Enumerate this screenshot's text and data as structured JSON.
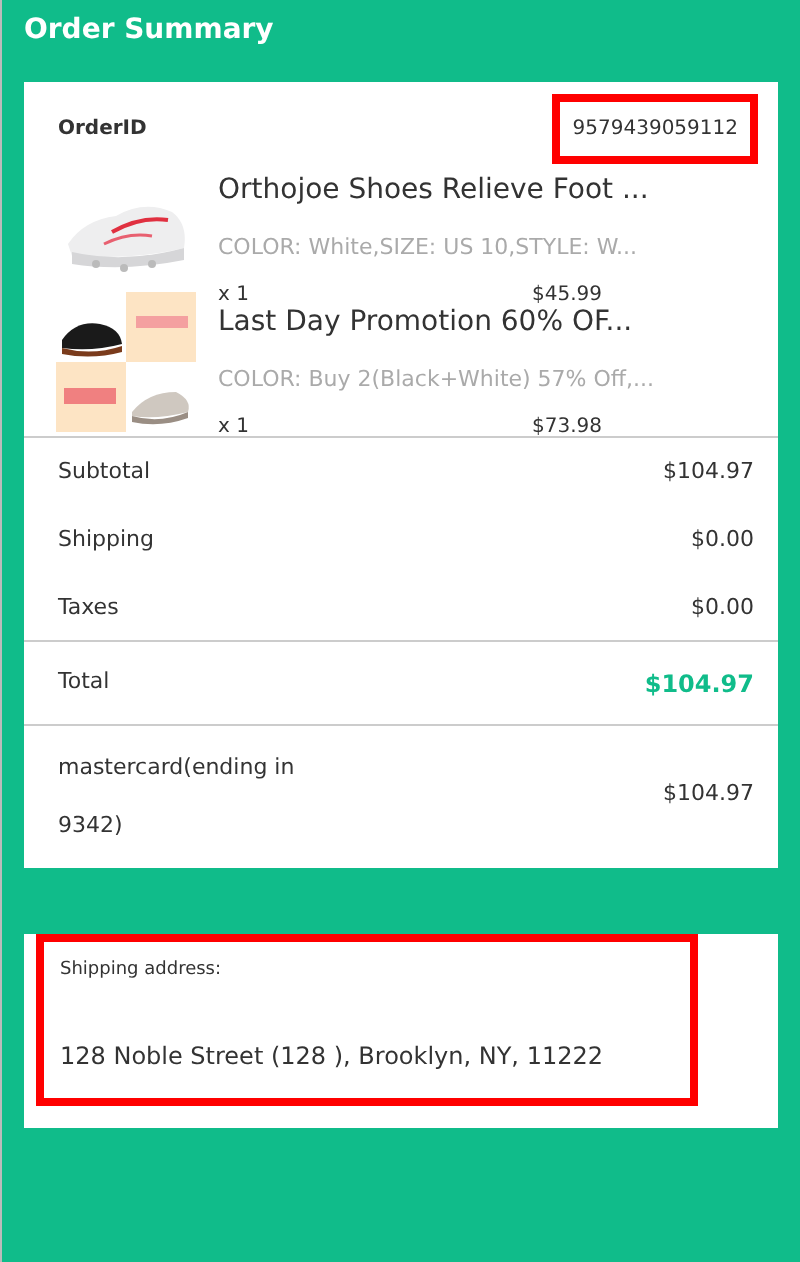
{
  "header": {
    "title": "Order Summary"
  },
  "order": {
    "label": "OrderID",
    "id": "9579439059112",
    "highlighted": true
  },
  "items": [
    {
      "title": "Orthojoe Shoes Relieve Foot ...",
      "options": "COLOR: White,SIZE: US 10,STYLE: W...",
      "quantity": "x 1",
      "price": "$45.99"
    },
    {
      "title": "Last Day Promotion 60% OF...",
      "options": "COLOR: Buy 2(Black+White) 57% Off,...",
      "quantity": "x 1",
      "price": "$73.98"
    }
  ],
  "costs": [
    {
      "label": "Subtotal",
      "value": "$104.97"
    },
    {
      "label": "Shipping",
      "value": "$0.00"
    },
    {
      "label": "Taxes",
      "value": "$0.00"
    }
  ],
  "total": {
    "label": "Total",
    "value": "$104.97"
  },
  "payment": {
    "method": "mastercard(ending in 9342)",
    "amount": "$104.97"
  },
  "shipping": {
    "label": "Shipping address:",
    "address": "128 Noble Street (128 ), Brooklyn, NY, 11222",
    "highlighted": true
  }
}
